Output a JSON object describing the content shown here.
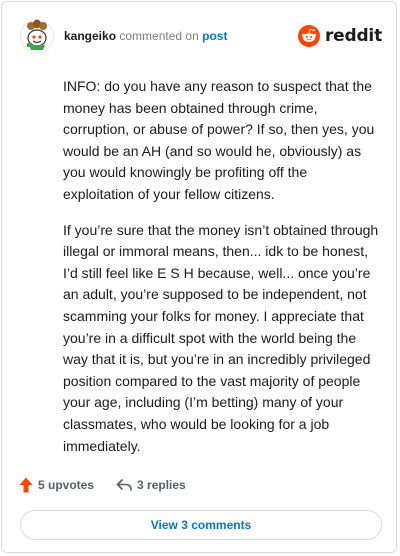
{
  "comment": {
    "author": "kangeiko",
    "action_text": "commented on",
    "target_link": "post",
    "paragraphs": [
      "INFO: do you have any reason to suspect that the money has been obtained through crime, corruption, or abuse of power? If so, then yes, you would be an AH (and so would he, obviously) as you would knowingly be profiting off the exploitation of your fellow citizens.",
      "If you’re sure that the money isn’t obtained through illegal or immoral means, then... idk to be honest, I’d still feel like E S H because, well... once you’re an adult, you’re supposed to be independent, not scamming your folks for money. I appreciate that you’re in a difficult spot with the world being the way that it is, but you’re in an incredibly privileged position compared to the vast majority of people your age, including (I’m betting) many of your classmates, who would be looking for a job immediately."
    ]
  },
  "brand": {
    "name": "reddit",
    "color": "#ff4500"
  },
  "actions": {
    "upvotes_label": "5 upvotes",
    "replies_label": "3 replies",
    "view_comments_label": "View 3 comments"
  },
  "icons": {
    "avatar": "avatar-icon",
    "brand": "reddit-logo-icon",
    "upvote": "upvote-arrow-icon",
    "reply": "reply-arrow-icon"
  },
  "colors": {
    "upvote": "#ff4500",
    "link": "#0079d3",
    "text": "#1c1c1c",
    "muted": "#5a5d60",
    "border": "#d9dcdf"
  }
}
